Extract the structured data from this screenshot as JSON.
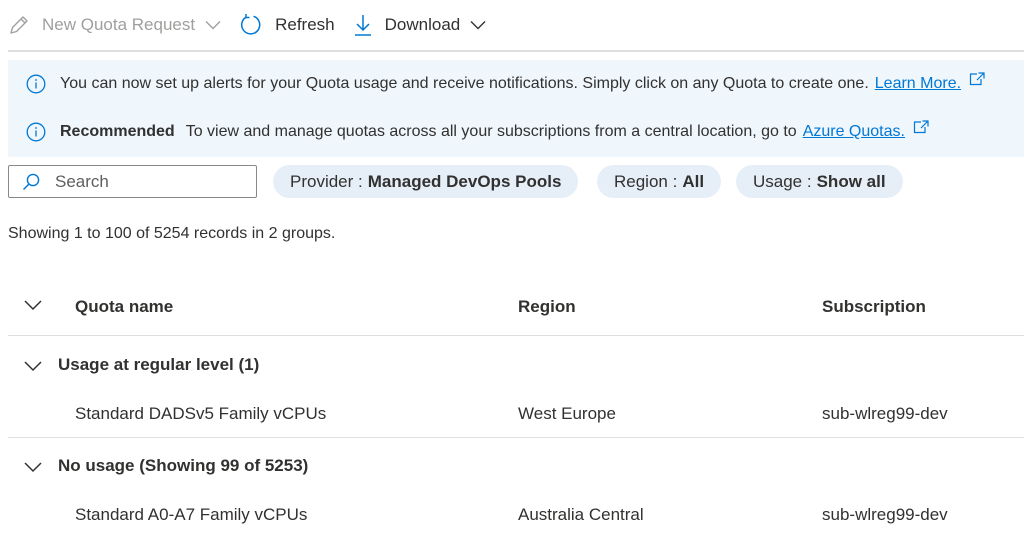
{
  "toolbar": {
    "new_quota_request": "New Quota Request",
    "refresh": "Refresh",
    "download": "Download"
  },
  "info": {
    "alerts_text": "You can now set up alerts for your Quota usage and receive notifications. Simply click on any Quota to create one.",
    "alerts_link": "Learn More.",
    "recommended_label": "Recommended",
    "recommended_text": "To view and manage quotas across all your subscriptions from a central location, go to",
    "recommended_link": "Azure Quotas."
  },
  "filters": {
    "search_placeholder": "Search",
    "provider_key": "Provider :",
    "provider_value": "Managed DevOps Pools",
    "region_key": "Region :",
    "region_value": "All",
    "usage_key": "Usage :",
    "usage_value": "Show all"
  },
  "records_summary": "Showing 1 to 100 of 5254 records in 2 groups.",
  "columns": {
    "quota_name": "Quota name",
    "region": "Region",
    "subscription": "Subscription"
  },
  "groups": [
    {
      "label": "Usage at regular level (1)",
      "rows": [
        {
          "quota_name": "Standard DADSv5 Family vCPUs",
          "region": "West Europe",
          "subscription": "sub-wlreg99-dev"
        }
      ]
    },
    {
      "label": "No usage (Showing 99 of 5253)",
      "rows": [
        {
          "quota_name": "Standard A0-A7 Family vCPUs",
          "region": "Australia Central",
          "subscription": "sub-wlreg99-dev"
        }
      ]
    }
  ],
  "colors": {
    "accent": "#0078d4",
    "info_background": "#eff6fc",
    "pill_background": "#e6eff8",
    "disabled_text": "#a19f9d"
  }
}
